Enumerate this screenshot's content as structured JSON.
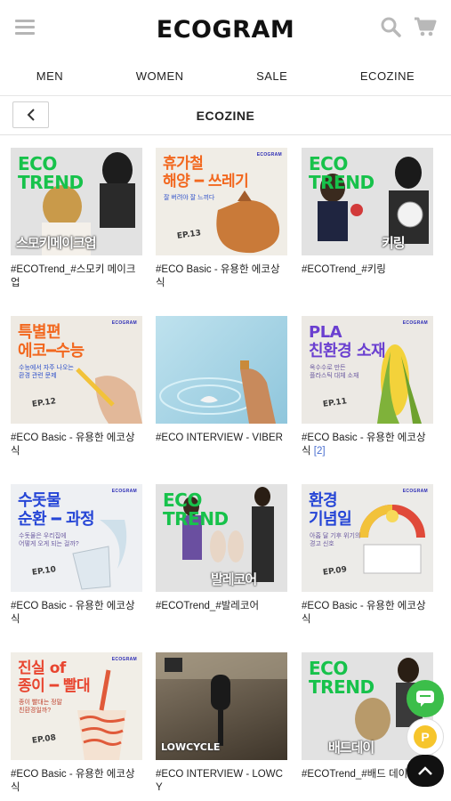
{
  "header": {
    "logo": "ECOGRAM"
  },
  "nav": [
    "MEN",
    "WOMEN",
    "SALE",
    "ECOZINE"
  ],
  "subbar": {
    "title": "ECOZINE"
  },
  "cards": [
    {
      "title": "#ECOTrend_#스모키 메이크업",
      "count": "",
      "thumb": {
        "bg": "#e3e3e3",
        "big": "ECO TREND",
        "bottom": "스모키메이크업"
      }
    },
    {
      "title": "#ECO Basic - 유용한 에코상식",
      "count": "",
      "thumb": {
        "bg": "#f0ede6",
        "big": "휴가철\n해양 ━ 쓰레기",
        "small": "잘 버려야 잘 느끼다",
        "ep": "EP.13",
        "brand": "ECOGRAM"
      }
    },
    {
      "title": "#ECOTrend_#키링",
      "count": "",
      "thumb": {
        "bg": "#e3e3e3",
        "big": "ECO TREND",
        "bottom": "키링"
      }
    },
    {
      "title": "#ECO Basic - 유용한 에코상식",
      "count": "",
      "thumb": {
        "bg": "#eeeae3",
        "big": "특별편\n에코━수능",
        "small": "수능에서 자주 나오는\n환경 관련 문제",
        "ep": "EP.12",
        "brand": "ECOGRAM"
      }
    },
    {
      "title": "#ECO INTERVIEW - VIBER",
      "count": "",
      "thumb": {
        "bg": "#a9d3e4"
      }
    },
    {
      "title": "#ECO Basic - 유용한 에코상식",
      "count": "[2]",
      "thumb": {
        "bg": "#ece9e4",
        "big": "PLA\n친환경 소재",
        "small": "옥수수로 만든\n플라스틱 대체 소재",
        "ep": "EP.11",
        "brand": "ECOGRAM"
      }
    },
    {
      "title": "#ECO Basic - 유용한 에코상식",
      "count": "",
      "thumb": {
        "bg": "#eef0f3",
        "big": "수돗물\n순환 ━ 과정",
        "small": "수돗물은 우리집에\n어떻게 오게 되는 걸까?",
        "ep": "EP.10",
        "brand": "ECOGRAM"
      }
    },
    {
      "title": "#ECOTrend_#발레코어",
      "count": "",
      "thumb": {
        "bg": "#e3e3e3",
        "big": "ECO TREND",
        "bottom": "발레코어"
      }
    },
    {
      "title": "#ECO Basic - 유용한 에코상식",
      "count": "",
      "thumb": {
        "bg": "#ecebe8",
        "big": "환경\n기념일",
        "small": "아홉 달 기후 위기의\n경고 신호",
        "ep": "EP.09",
        "brand": "ECOGRAM"
      }
    },
    {
      "title": "#ECO Basic - 유용한 에코상식",
      "count": "",
      "thumb": {
        "bg": "#f1eee7",
        "big": "진실 of\n종이 ━ 빨대",
        "small": "종이 빨대는 정말\n친환경일까?",
        "ep": "EP.08",
        "brand": "ECOGRAM"
      }
    },
    {
      "title": "#ECO INTERVIEW - LOWCY",
      "count": "",
      "thumb": {
        "bg": "#6d6252",
        "bottom": "LOWCYCLE"
      }
    },
    {
      "title": "#ECOTrend_#배드 데이",
      "count": "",
      "thumb": {
        "bg": "#e3e3e3",
        "big": "ECO TREND",
        "bottom": "배드데이"
      }
    }
  ]
}
